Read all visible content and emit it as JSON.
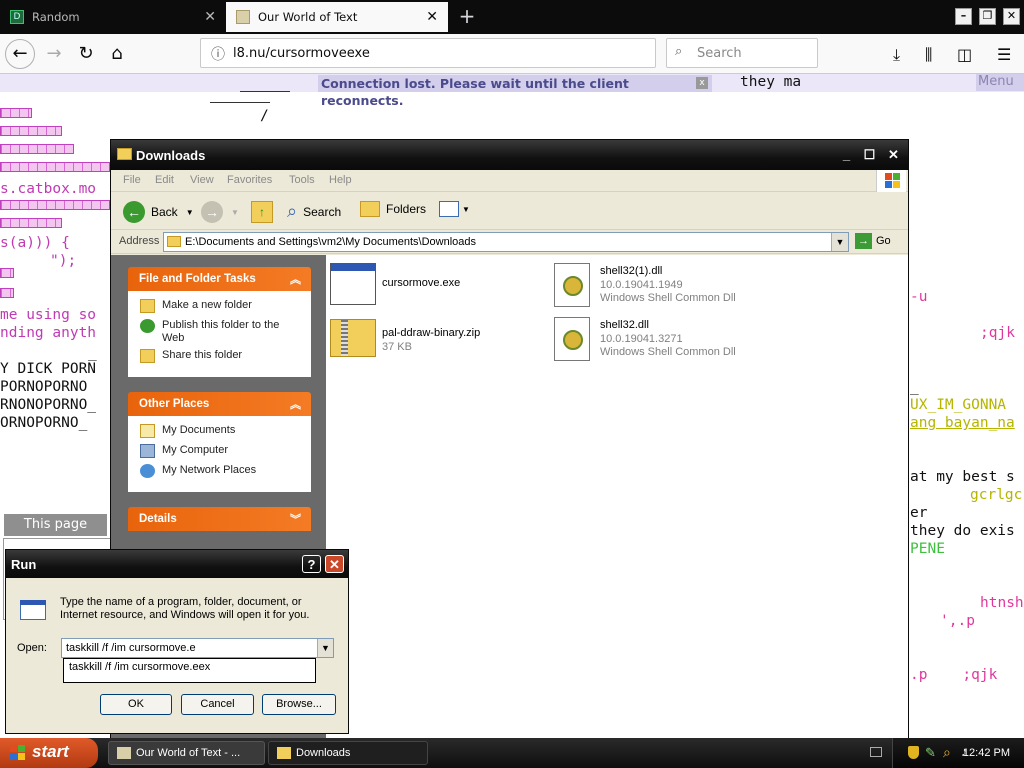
{
  "browser": {
    "tabs": [
      {
        "label": "Random",
        "active": false
      },
      {
        "label": "Our World of Text",
        "active": true
      }
    ],
    "url": "l8.nu/cursormoveexe",
    "search_placeholder": "Search"
  },
  "page": {
    "connection_message": "Connection lost. Please wait until the client reconnects.",
    "close_x": "x",
    "menu_label": "Menu",
    "this_page_label": "This page",
    "text_fragments": {
      "top_mid": "they ma",
      "catbox": "s.catbox.mo",
      "sa": "s(a))) {",
      "semi": "\");",
      "me_using": "me using so",
      "nding": "nding anyth",
      "dick": "Y DICK PORN",
      "porno1": "PORNOPORNO",
      "porno2": "RNONOPORNO_",
      "porno3": "ORNOPORNO_",
      "r_u": "-u",
      "r_qjk": ";qjk",
      "r_ux": "UX_IM_GONNA",
      "r_bayan": "ang bayan_na",
      "r_best": "at my best s",
      "r_gcrl": "gcrlgc",
      "r_er": "er",
      "r_they": "they do exis",
      "r_pene": "PENE",
      "r_htns": "htnsh",
      "r_p1": "',.p",
      "r_p2": ".p    ;qjk"
    }
  },
  "explorer": {
    "title": "Downloads",
    "menu": [
      "File",
      "Edit",
      "View",
      "Favorites",
      "Tools",
      "Help"
    ],
    "toolbar": {
      "back": "Back",
      "search": "Search",
      "folders": "Folders"
    },
    "address_label": "Address",
    "address": "E:\\Documents and Settings\\vm2\\My Documents\\Downloads",
    "go": "Go",
    "tasks_panel": {
      "title": "File and Folder Tasks",
      "items": [
        "Make a new folder",
        "Publish this folder to the Web",
        "Share this folder"
      ]
    },
    "places_panel": {
      "title": "Other Places",
      "items": [
        "My Documents",
        "My Computer",
        "My Network Places"
      ]
    },
    "details_panel": {
      "title": "Details"
    },
    "files": [
      {
        "name": "cursormove.exe",
        "line2": "",
        "line3": "",
        "icon": "app-window-icon"
      },
      {
        "name": "shell32(1).dll",
        "line2": "10.0.19041.1949",
        "line3": "Windows Shell Common Dll",
        "icon": "dll-gear-icon"
      },
      {
        "name": "pal-ddraw-binary.zip",
        "line2": "37 KB",
        "line3": "",
        "icon": "zip-folder-icon"
      },
      {
        "name": "shell32.dll",
        "line2": "10.0.19041.3271",
        "line3": "Windows Shell Common Dll",
        "icon": "dll-gear-icon"
      }
    ]
  },
  "run": {
    "title": "Run",
    "description": "Type the name of a program, folder, document, or Internet resource, and Windows will open it for you.",
    "open_label": "Open:",
    "input_value": "taskkill /f /im cursormove.e",
    "autocomplete": "taskkill /f /im cursormove.eex",
    "buttons": {
      "ok": "OK",
      "cancel": "Cancel",
      "browse": "Browse..."
    }
  },
  "taskbar": {
    "start": "start",
    "tasks": [
      {
        "label": "Our World of Text - ..."
      },
      {
        "label": "Downloads"
      }
    ],
    "clock": "12:42 PM"
  }
}
